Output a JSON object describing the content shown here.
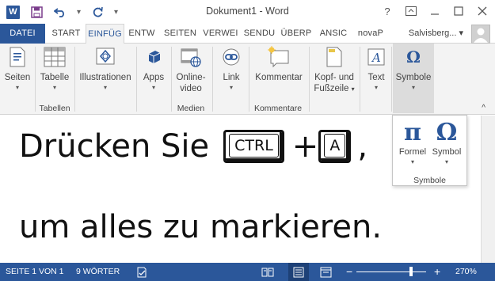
{
  "titlebar": {
    "title": "Dokument1 - Word",
    "app_logo": "W",
    "qat_icons": [
      "word-logo-icon",
      "save-icon",
      "undo-icon",
      "redo-icon",
      "customize-qat-icon"
    ],
    "window_controls": {
      "help": "?",
      "restore_ribbon": "ribbon-display-icon",
      "minimize": "—",
      "maximize": "☐",
      "close": "✕"
    }
  },
  "tabs": {
    "file": "DATEI",
    "items": [
      "START",
      "EINFÜG",
      "ENTW",
      "SEITEN",
      "VERWEI",
      "SENDU",
      "ÜBERP",
      "ANSIC",
      "novaP"
    ],
    "active": "EINFÜG",
    "user_name": "Salvisberg...",
    "user_caret": "▾"
  },
  "ribbon": {
    "buttons": {
      "seiten": "Seiten",
      "tabelle": "Tabelle",
      "illustrationen": "Illustrationen",
      "apps": "Apps",
      "online_video_1": "Online-",
      "online_video_2": "video",
      "link": "Link",
      "kommentar": "Kommentar",
      "kopf_1": "Kopf- und",
      "kopf_2": "Fußzeile",
      "text": "Text",
      "symbole": "Symbole"
    },
    "groups": {
      "tabellen": "Tabellen",
      "medien": "Medien",
      "kommentare": "Kommentare"
    },
    "caret": "▾",
    "collapse": "^"
  },
  "flyout": {
    "formel_symbol": "π",
    "formel_label": "Formel",
    "symbol_symbol": "Ω",
    "symbol_label": "Symbol",
    "group_label": "Symbole"
  },
  "document": {
    "line1_part1": "Drücken Sie",
    "key1": "CTRL",
    "plus": "+",
    "key2": "A",
    "comma": ",",
    "line2": "um alles zu markieren."
  },
  "statusbar": {
    "page_info": "SEITE 1 VON 1",
    "word_count": "9 WÖRTER",
    "zoom_minus": "−",
    "zoom_plus": "+",
    "zoom_level": "270%",
    "zoom_value_percent": 270
  },
  "colors": {
    "word_blue": "#2b579a",
    "ribbon_bg": "#f3f3f3",
    "text_dark": "#444444"
  }
}
